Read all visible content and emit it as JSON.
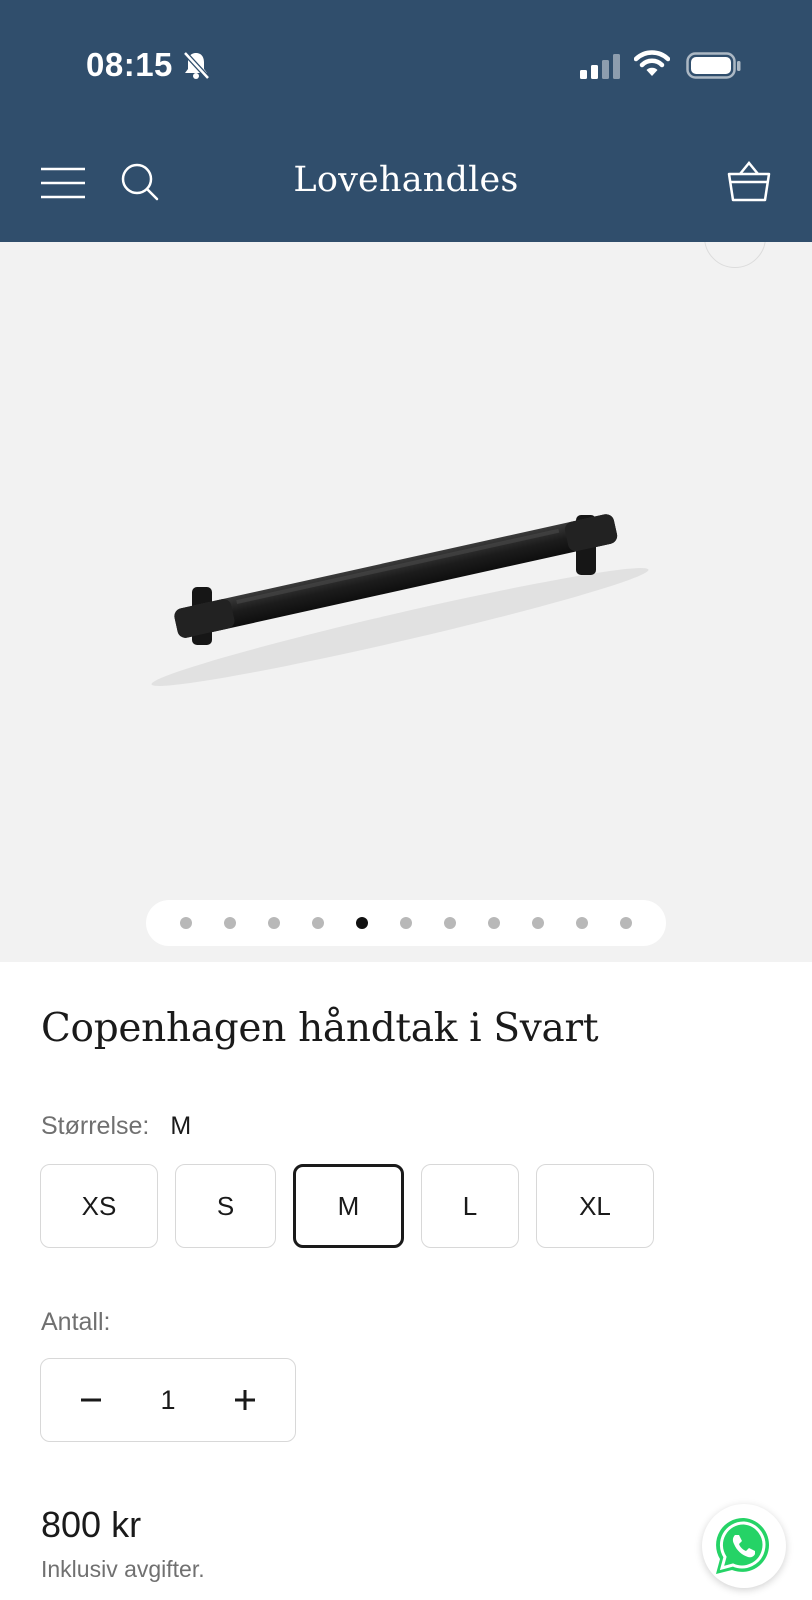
{
  "status_bar": {
    "time": "08:15"
  },
  "header": {
    "brand": "Lovehandles"
  },
  "gallery": {
    "slide_count": 11,
    "active_index": 4
  },
  "product": {
    "title": "Copenhagen håndtak i Svart",
    "size_label": "Størrelse:",
    "size_selected": "M",
    "sizes": [
      "XS",
      "S",
      "M",
      "L",
      "XL"
    ],
    "quantity_label": "Antall:",
    "quantity": "1",
    "price": "800 kr",
    "tax_note": "Inklusiv avgifter."
  },
  "colors": {
    "header_bg": "#304e6c",
    "gallery_bg": "#f2f2f2",
    "whatsapp": "#25d366"
  }
}
